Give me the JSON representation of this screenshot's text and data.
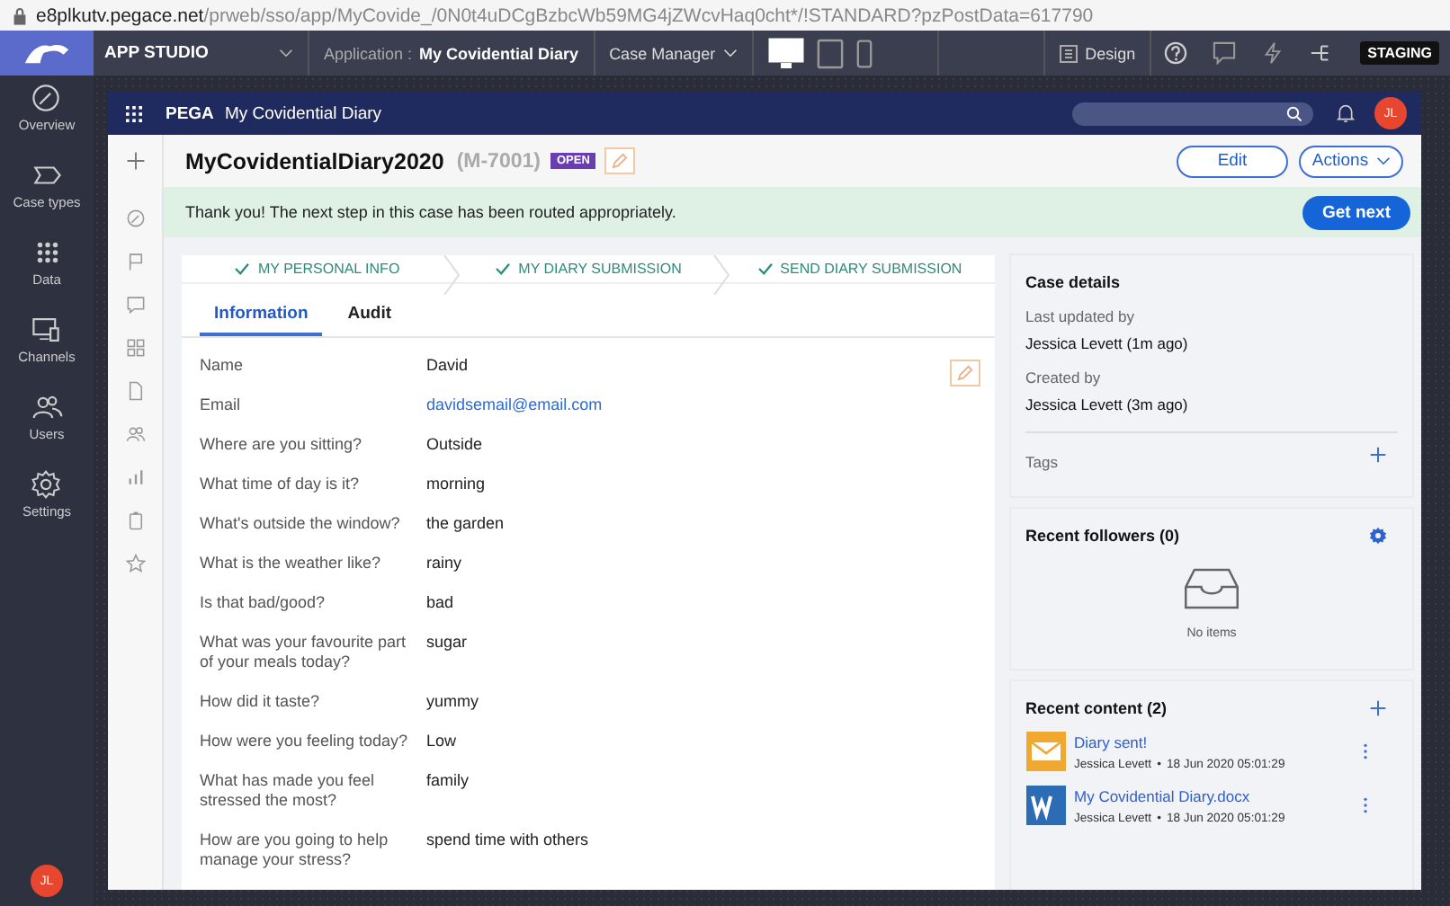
{
  "browser": {
    "url_host": "e8plkutv.pegace.net",
    "url_path": "/prweb/sso/app/MyCovide_/0N0t4uDCgBzbcWb59MG4jZWcvHaq0cht*/!STANDARD?pzPostData=617790"
  },
  "app_bar": {
    "menu": "APP STUDIO",
    "application_label": "Application :",
    "application_name": "My Covidential Diary",
    "portal": "Case Manager",
    "devices": [
      {
        "kind": "desktop",
        "selected": true
      },
      {
        "kind": "tablet",
        "selected": false
      },
      {
        "kind": "phone",
        "selected": false
      }
    ],
    "design": "Design",
    "environment": "STAGING"
  },
  "nav": {
    "items": [
      {
        "kind": "overview",
        "label": "Overview"
      },
      {
        "kind": "casetypes",
        "label": "Case types"
      },
      {
        "kind": "data",
        "label": "Data"
      },
      {
        "kind": "channels",
        "label": "Channels"
      },
      {
        "kind": "users",
        "label": "Users"
      },
      {
        "kind": "settings",
        "label": "Settings"
      }
    ],
    "user_initials": "JL"
  },
  "portal": {
    "brand": "PEGA",
    "title": "My Covidential Diary",
    "user_initials": "JL"
  },
  "side_tools": [
    {
      "kind": "plus"
    },
    {
      "kind": "gauge"
    },
    {
      "kind": "flag"
    },
    {
      "kind": "chat"
    },
    {
      "kind": "grid"
    },
    {
      "kind": "document"
    },
    {
      "kind": "users"
    },
    {
      "kind": "bars"
    },
    {
      "kind": "clipboard"
    },
    {
      "kind": "star"
    }
  ],
  "case": {
    "title": "MyCovidentialDiary2020",
    "id": "(M-7001)",
    "status": "OPEN",
    "edit": "Edit",
    "actions": "Actions",
    "banner": "Thank you! The next step in this case has been routed appropriately.",
    "get_next": "Get next"
  },
  "stages": [
    {
      "label": "MY PERSONAL INFO",
      "completed": true
    },
    {
      "label": "MY DIARY SUBMISSION",
      "completed": true
    },
    {
      "label": "SEND DIARY SUBMISSION",
      "completed": true
    }
  ],
  "tabs": [
    {
      "label": "Information",
      "selected": true
    },
    {
      "label": "Audit",
      "selected": false
    }
  ],
  "fields": [
    {
      "label": "Name",
      "value": "David",
      "kind": "text"
    },
    {
      "label": "Email",
      "value": "davidsemail@email.com",
      "kind": "link"
    },
    {
      "label": "Where are you sitting?",
      "value": "Outside",
      "kind": "text"
    },
    {
      "label": "What time of day is it?",
      "value": "morning",
      "kind": "text"
    },
    {
      "label": "What's outside the window?",
      "value": "the garden",
      "kind": "text"
    },
    {
      "label": "What is the weather like?",
      "value": "rainy",
      "kind": "text"
    },
    {
      "label": "Is that bad/good?",
      "value": "bad",
      "kind": "text"
    },
    {
      "label": "What was your favourite part of your meals today?",
      "value": "sugar",
      "kind": "text"
    },
    {
      "label": "How did it taste?",
      "value": "yummy",
      "kind": "text"
    },
    {
      "label": "How were you feeling today?",
      "value": "Low",
      "kind": "text"
    },
    {
      "label": "What has made you feel stressed the most?",
      "value": "family",
      "kind": "text"
    },
    {
      "label": "How are you going to help manage your stress?",
      "value": "spend time with others",
      "kind": "text"
    }
  ],
  "case_details": {
    "title": "Case details",
    "items": [
      {
        "label": "Last updated by",
        "value": "Jessica Levett (1m ago)"
      },
      {
        "label": "Created by",
        "value": "Jessica Levett (3m ago)"
      }
    ],
    "tags": "Tags"
  },
  "followers": {
    "title": "Recent followers (0)",
    "empty": "No items"
  },
  "recent_content": {
    "title": "Recent content (2)",
    "separator": "•",
    "items": [
      {
        "kind": "mail",
        "title": "Diary sent!",
        "author": "Jessica Levett",
        "date": "18 Jun 2020 05:01:29"
      },
      {
        "kind": "word",
        "title": "My Covidential Diary.docx",
        "author": "Jessica Levett",
        "date": "18 Jun 2020 05:01:29"
      }
    ]
  }
}
